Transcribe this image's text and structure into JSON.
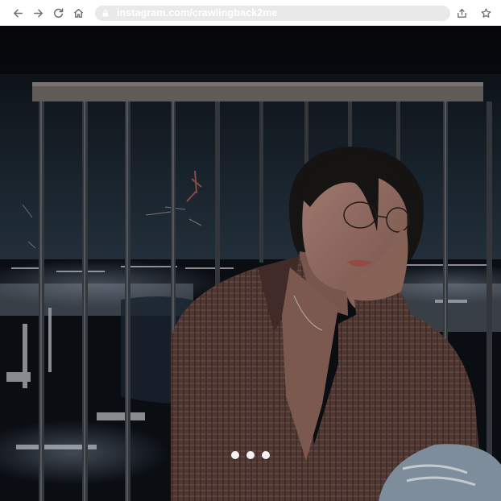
{
  "browser": {
    "url": "instagram.com/crawlingback2me",
    "toolbar_icons": [
      "back-arrow-icon",
      "forward-arrow-icon",
      "reload-icon",
      "home-icon",
      "lock-icon",
      "share-icon",
      "star-icon"
    ]
  },
  "post": {
    "slide_count": 3,
    "active_slide": 1,
    "colors": {
      "dot": "#f4f4f4",
      "sky": "#24313d",
      "shirt": "#5a3e38"
    }
  }
}
